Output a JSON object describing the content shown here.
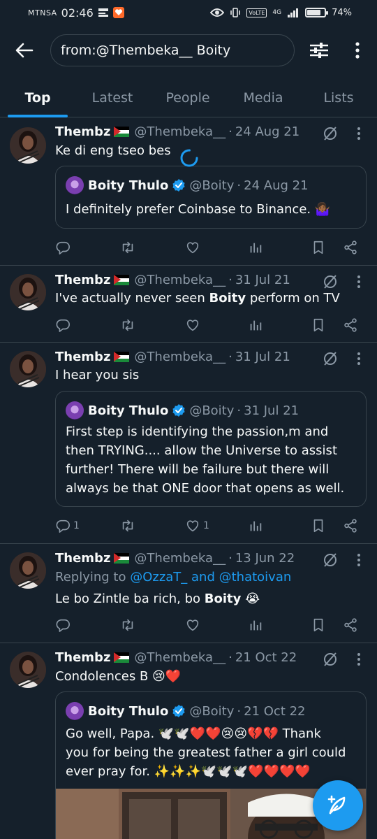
{
  "status_bar": {
    "carrier": "MTNSA",
    "time": "02:46",
    "network": "4G",
    "volte": "VoLTE",
    "battery": "74%",
    "battery_level": 0.74
  },
  "search": {
    "query": "from:@Thembeka__ Boity"
  },
  "tabs": [
    {
      "label": "Top"
    },
    {
      "label": "Latest"
    },
    {
      "label": "People"
    },
    {
      "label": "Media"
    },
    {
      "label": "Lists"
    }
  ],
  "tweets": [
    {
      "name": "Thembz",
      "handle": "@Thembeka__",
      "date": "24 Aug 21",
      "text": "Ke di eng tseo bes",
      "quote": {
        "name": "Boity Thulo",
        "handle": "@Boity",
        "date": "24 Aug 21",
        "text": "I definitely prefer Coinbase to Binance. 🤷🏾‍♀️"
      }
    },
    {
      "name": "Thembz",
      "handle": "@Thembeka__",
      "date": "31 Jul 21",
      "text_before": "I've actually never seen ",
      "text_bold": "Boity",
      "text_after": " perform on TV"
    },
    {
      "name": "Thembz",
      "handle": "@Thembeka__",
      "date": "31 Jul 21",
      "text": "I hear you sis",
      "quote": {
        "name": "Boity Thulo",
        "handle": "@Boity",
        "date": "31 Jul 21",
        "text": "First step is identifying the passion,m and\nthen TRYING.... allow the Universe to assist\nfurther! There will be failure but there will\nalways be that ONE door that opens as well."
      },
      "reply_count": "1",
      "like_count": "1"
    },
    {
      "name": "Thembz",
      "handle": "@Thembeka__",
      "date": "13 Jun 22",
      "replying_label": "Replying to ",
      "replying_to": "@OzzaT_ and @thatoivan",
      "text_before": "Le bo Zintle ba rich, bo ",
      "text_bold": "Boity",
      "text_after": " 😭"
    },
    {
      "name": "Thembz",
      "handle": "@Thembeka__",
      "date": "21 Oct 22",
      "text": "Condolences B 😢❤️",
      "quote": {
        "name": "Boity Thulo",
        "handle": "@Boity",
        "date": "21 Oct 22",
        "text": "Go well, Papa. 🕊️🕊️❤️❤️😢😢💔💔 Thank\nyou for being the greatest father a girl could\never pray for. ✨✨✨🕊️🕊️🕊️❤️❤️❤️❤️"
      }
    }
  ],
  "colors": {
    "background": "#15202b",
    "accent": "#1d9bf0",
    "muted": "#8b98a5",
    "border": "#38444d"
  }
}
